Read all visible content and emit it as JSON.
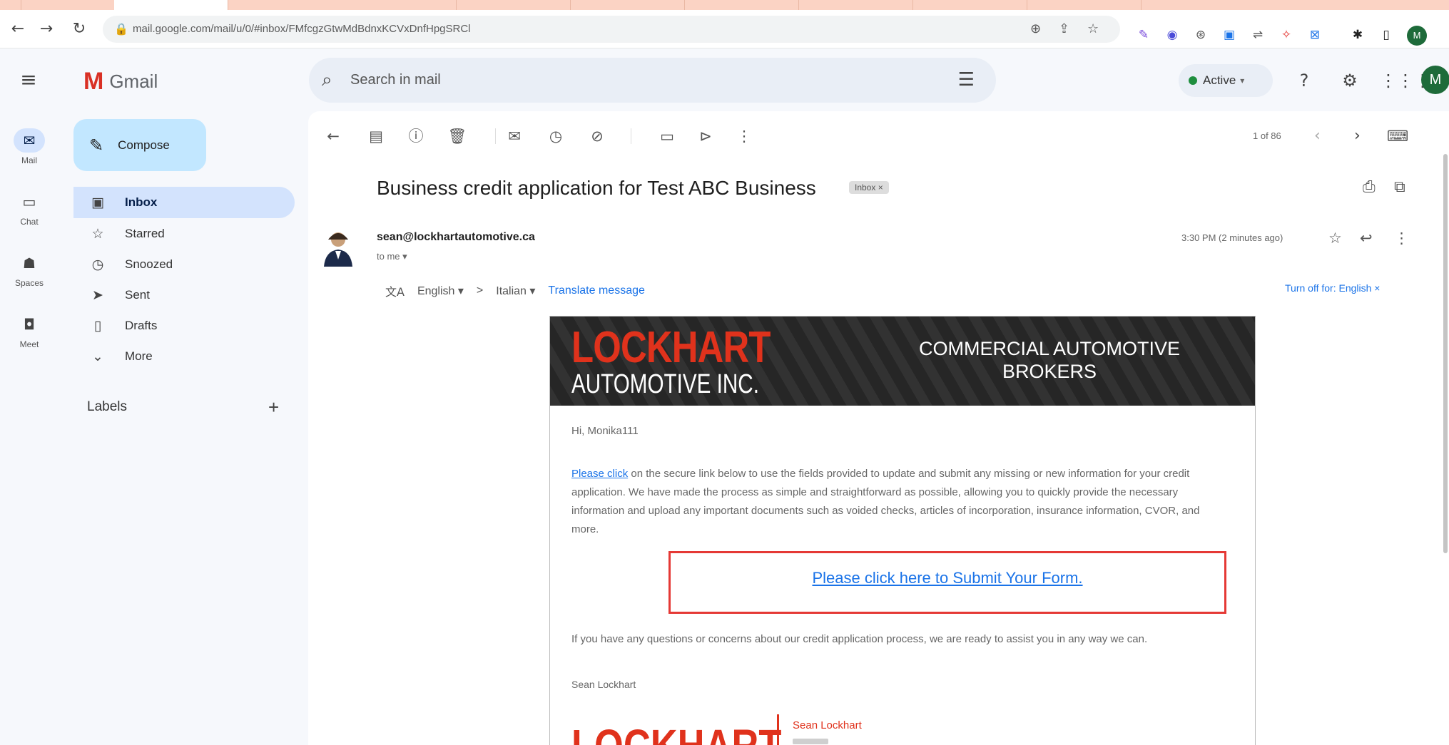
{
  "browser": {
    "url": "mail.google.com/mail/u/0/#inbox/FMfcgzGtwMdBdnxKCVxDnfHpgSRCl",
    "profile_initial": "M"
  },
  "gmail": {
    "logo_text": "Gmail",
    "search_placeholder": "Search in mail",
    "status": "Active",
    "avatar_initial": "M"
  },
  "rail": [
    {
      "label": "Mail",
      "icon": "mail-icon",
      "active": true
    },
    {
      "label": "Chat",
      "icon": "chat-icon",
      "active": false
    },
    {
      "label": "Spaces",
      "icon": "spaces-icon",
      "active": false
    },
    {
      "label": "Meet",
      "icon": "meet-icon",
      "active": false
    }
  ],
  "sidebar": {
    "compose": "Compose",
    "items": [
      {
        "label": "Inbox",
        "icon": "inbox-icon",
        "active": true
      },
      {
        "label": "Starred",
        "icon": "star-icon"
      },
      {
        "label": "Snoozed",
        "icon": "clock-icon"
      },
      {
        "label": "Sent",
        "icon": "send-icon"
      },
      {
        "label": "Drafts",
        "icon": "draft-icon"
      },
      {
        "label": "More",
        "icon": "chevron-down-icon"
      }
    ],
    "labels_heading": "Labels"
  },
  "toolbar": {
    "pager": "1 of 86"
  },
  "message": {
    "subject": "Business credit application for Test ABC Business",
    "folder_chip": "Inbox ×",
    "sender": "sean@lockhartautomotive.ca",
    "to": "to me ▾",
    "timestamp": "3:30 PM (2 minutes ago)",
    "translate": {
      "from": "English ▾",
      "arrow": ">",
      "to": "Italian ▾",
      "action": "Translate message",
      "turn_off": "Turn off for: English ×"
    }
  },
  "email": {
    "brand_line1": "LOCKHART",
    "brand_line2": "AUTOMOTIVE INC.",
    "tagline_1": "COMMERCIAL AUTOMOTIVE",
    "tagline_2": "BROKERS",
    "greeting": "Hi, Monika111",
    "body_link": "Please click",
    "body_text": " on the secure link below to use the fields provided to update and submit any missing or new information for your credit application. We have made the process as simple and straightforward as possible, allowing you to quickly provide the necessary information and upload any important documents such as voided checks, articles of incorporation, insurance information, CVOR, and more.",
    "cta": "Please click here to Submit Your Form.",
    "closing": "If you have any questions or concerns about our credit application process, we are ready to assist you in any way we can.",
    "signature_name": "Sean Lockhart",
    "sig_logo": "LOCKHART",
    "sig_person": "Sean Lockhart"
  }
}
